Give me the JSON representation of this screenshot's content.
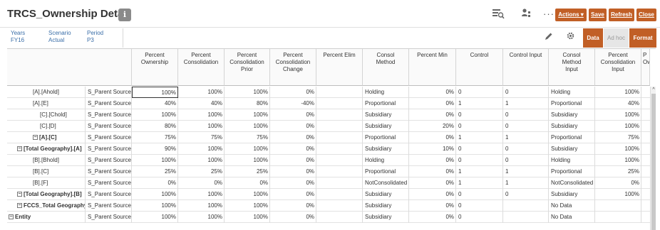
{
  "header": {
    "title": "TRCS_Ownership Detail",
    "info_label": "i",
    "actions_label": "Actions ▾",
    "save_label": "Save",
    "refresh_label": "Refresh",
    "close_label": "Close",
    "more_label": "···"
  },
  "pov": [
    {
      "dim": "Years",
      "value": "FY16"
    },
    {
      "dim": "Scenario",
      "value": "Actual"
    },
    {
      "dim": "Period",
      "value": "P3"
    }
  ],
  "tabs": {
    "data": "Data",
    "adhoc": "Ad hoc",
    "format": "Format"
  },
  "columns": [
    "Percent Ownership",
    "Percent Consolidation",
    "Percent Consolidation Prior",
    "Percent Consolidation Change",
    "Percent Elim",
    "Consol Method",
    "Percent Min",
    "Control",
    "Control Input",
    "Consol Method Input",
    "Percent Consolidation Input",
    "P Ow"
  ],
  "rows": [
    {
      "entity": "[A].[Ahold]",
      "source": "S_Parent Source",
      "cells": [
        "100%",
        "100%",
        "100%",
        "0%",
        "",
        "Holding",
        "0%",
        "0",
        "0",
        "Holding",
        "100%"
      ]
    },
    {
      "entity": "[A].[E]",
      "source": "S_Parent Source",
      "cells": [
        "40%",
        "40%",
        "80%",
        "-40%",
        "",
        "Proportional",
        "0%",
        "1",
        "1",
        "Proportional",
        "40%"
      ]
    },
    {
      "entity": "[C].[Chold]",
      "source": "S_Parent Source",
      "cells": [
        "100%",
        "100%",
        "100%",
        "0%",
        "",
        "Subsidiary",
        "0%",
        "0",
        "0",
        "Subsidiary",
        "100%"
      ]
    },
    {
      "entity": "[C].[D]",
      "source": "S_Parent Source",
      "cells": [
        "80%",
        "100%",
        "100%",
        "0%",
        "",
        "Subsidiary",
        "20%",
        "0",
        "0",
        "Subsidiary",
        "100%"
      ]
    },
    {
      "entity": "[A].[C]",
      "source": "S_Parent Source",
      "cells": [
        "75%",
        "75%",
        "75%",
        "0%",
        "",
        "Proportional",
        "0%",
        "1",
        "1",
        "Proportional",
        "75%"
      ]
    },
    {
      "entity": "[Total Geography].[A]",
      "source": "S_Parent Source",
      "cells": [
        "90%",
        "100%",
        "100%",
        "0%",
        "",
        "Subsidiary",
        "10%",
        "0",
        "0",
        "Subsidiary",
        "100%"
      ]
    },
    {
      "entity": "[B].[Bhold]",
      "source": "S_Parent Source",
      "cells": [
        "100%",
        "100%",
        "100%",
        "0%",
        "",
        "Holding",
        "0%",
        "0",
        "0",
        "Holding",
        "100%"
      ]
    },
    {
      "entity": "[B].[C]",
      "source": "S_Parent Source",
      "cells": [
        "25%",
        "25%",
        "25%",
        "0%",
        "",
        "Proportional",
        "0%",
        "1",
        "1",
        "Proportional",
        "25%"
      ]
    },
    {
      "entity": "[B].[F]",
      "source": "S_Parent Source",
      "cells": [
        "0%",
        "0%",
        "0%",
        "0%",
        "",
        "NotConsolidated",
        "0%",
        "1",
        "1",
        "NotConsolidated",
        "0%"
      ]
    },
    {
      "entity": "[Total Geography].[B]",
      "source": "S_Parent Source",
      "cells": [
        "100%",
        "100%",
        "100%",
        "0%",
        "",
        "Subsidiary",
        "0%",
        "0",
        "0",
        "Subsidiary",
        "100%"
      ]
    },
    {
      "entity": "FCCS_Total Geography",
      "source": "S_Parent Source",
      "cells": [
        "100%",
        "100%",
        "100%",
        "0%",
        "",
        "Subsidiary",
        "0%",
        "0",
        "",
        "No Data",
        ""
      ]
    },
    {
      "entity": "Entity",
      "source": "S_Parent Source",
      "cells": [
        "100%",
        "100%",
        "100%",
        "0%",
        "",
        "Subsidiary",
        "0%",
        "0",
        "",
        "No Data",
        ""
      ]
    }
  ],
  "colors": {
    "accent": "#c15f26",
    "pov_text": "#3a6ea8",
    "tab_inactive_bg": "#e6e6e6"
  },
  "icons": {
    "tool1": "explore-icon",
    "tool2": "user-hierarchy-icon",
    "edit": "pencil-icon",
    "settings": "gear-icon"
  }
}
